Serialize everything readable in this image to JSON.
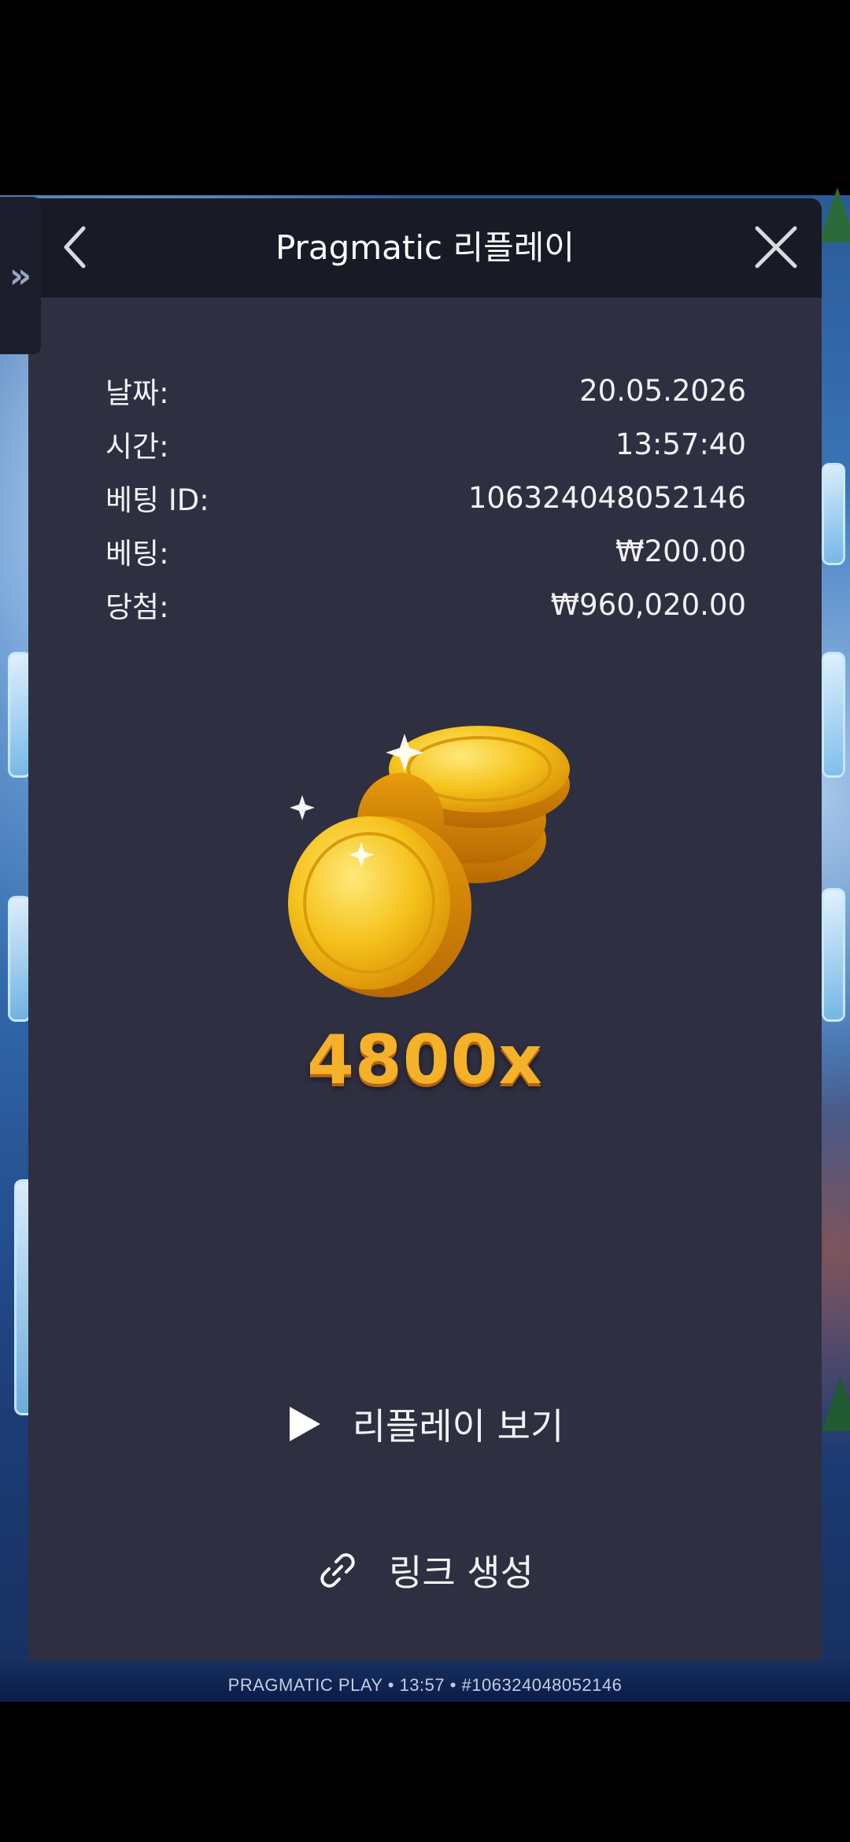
{
  "modal": {
    "title": "Pragmatic 리플레이",
    "back_icon": "chevron-left-icon",
    "close_icon": "close-icon"
  },
  "info": [
    {
      "label": "날짜:",
      "value": "20.05.2026"
    },
    {
      "label": "시간:",
      "value": "13:57:40"
    },
    {
      "label": "베팅 ID:",
      "value": "106324048052146"
    },
    {
      "label": "베팅:",
      "value": "₩200.00"
    },
    {
      "label": "당첨:",
      "value": "₩960,020.00"
    }
  ],
  "win": {
    "multiplier": "4800x",
    "icon": "gold-coins-icon"
  },
  "actions": {
    "replay_label": "리플레이 보기",
    "replay_icon": "play-icon",
    "link_label": "링크 생성",
    "link_icon": "link-icon"
  },
  "background": {
    "footer_text": "PRAGMATIC PLAY • 13:57 • #106324048052146",
    "side_tab_icon": "double-chevron-right-icon"
  },
  "colors": {
    "modal_bg": "#2e2f41",
    "header_bg": "#181a25",
    "multiplier": "#f5b12a"
  }
}
